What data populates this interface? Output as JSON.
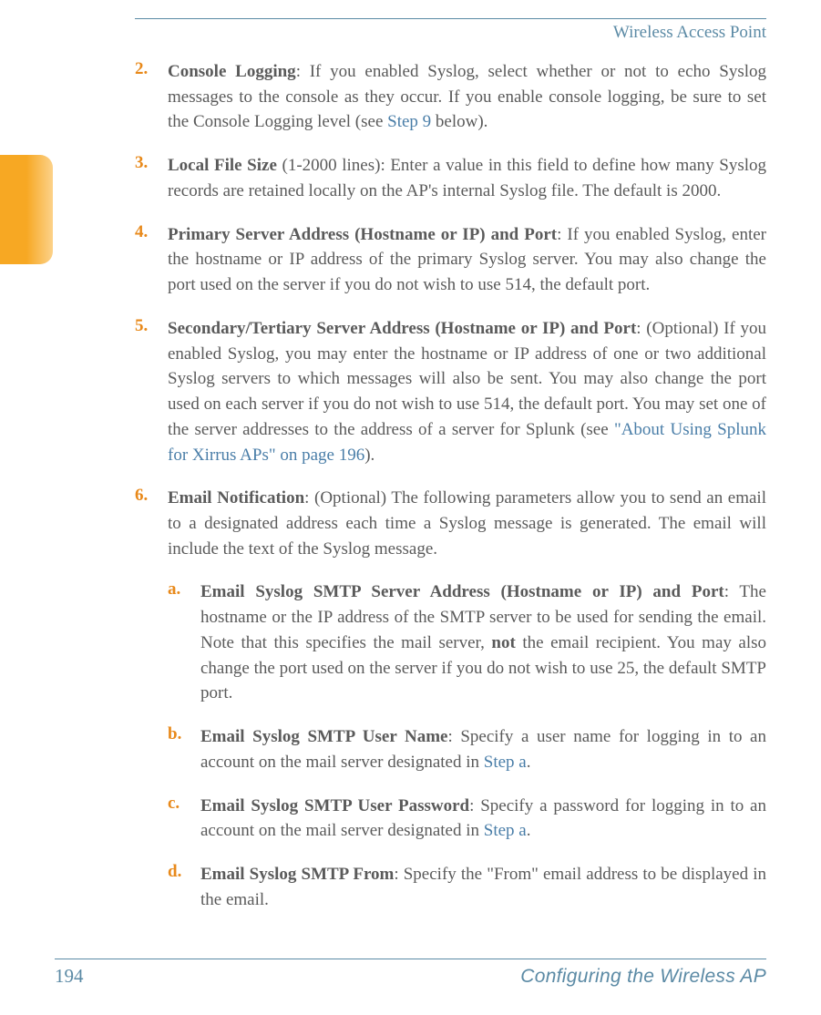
{
  "header": {
    "title": "Wireless Access Point"
  },
  "items": {
    "i2": {
      "marker": "2.",
      "bold": "Console Logging",
      "text_a": ": If you enabled Syslog, select whether or not to echo Syslog messages to the console as they occur. If you enable console logging, be sure to set the Console Logging level (see ",
      "link": "Step 9",
      "text_b": " below)."
    },
    "i3": {
      "marker": "3.",
      "bold": "Local File Size",
      "text": " (1-2000 lines): Enter a value in this field to define how many Syslog records are retained locally on the AP's internal Syslog file. The default is 2000."
    },
    "i4": {
      "marker": "4.",
      "bold": "Primary Server Address (Hostname or IP) and Port",
      "text": ": If you enabled Syslog, enter the hostname or IP address of the primary Syslog server. You may also change the port used on the server if you do not wish to use 514, the default port."
    },
    "i5": {
      "marker": "5.",
      "bold": "Secondary/Tertiary Server Address (Hostname or IP) and Port",
      "text_a": ": (Optional) If you enabled Syslog, you may enter the hostname or IP address of one or two additional Syslog servers to which messages will also be sent. You may also change the port used on each server if you do not wish to use 514, the default port. You may set one of the server addresses to the address of a server for Splunk (see ",
      "link": "\"About Using Splunk for Xirrus APs\" on page 196",
      "text_b": ")."
    },
    "i6": {
      "marker": "6.",
      "bold": "Email Notification",
      "text": ": (Optional) The following parameters allow you to send an email to a designated address each time a Syslog message is generated. The email will include the text of the Syslog message."
    }
  },
  "sub": {
    "a": {
      "marker": "a.",
      "bold": "Email Syslog SMTP Server Address (Hostname or IP) and Port",
      "text_a": ": The hostname or the IP address of the SMTP server to be used for sending the email. Note that this specifies the mail server, ",
      "bold2": "not",
      "text_b": " the email recipient. You may also change the port used on the server if you do not wish to use 25, the default SMTP port."
    },
    "b": {
      "marker": "b.",
      "bold": "Email Syslog SMTP User Name",
      "text_a": ": Specify a user name for logging in to an account on the mail server designated in ",
      "link": "Step a",
      "text_b": "."
    },
    "c": {
      "marker": "c.",
      "bold": "Email Syslog SMTP User Password",
      "text_a": ": Specify a password for logging in to an account on the mail server designated in ",
      "link": "Step a",
      "text_b": "."
    },
    "d": {
      "marker": "d.",
      "bold": "Email Syslog SMTP From",
      "text": ": Specify the \"From\" email address to be displayed in the email."
    }
  },
  "footer": {
    "page": "194",
    "title": "Configuring the Wireless AP"
  }
}
